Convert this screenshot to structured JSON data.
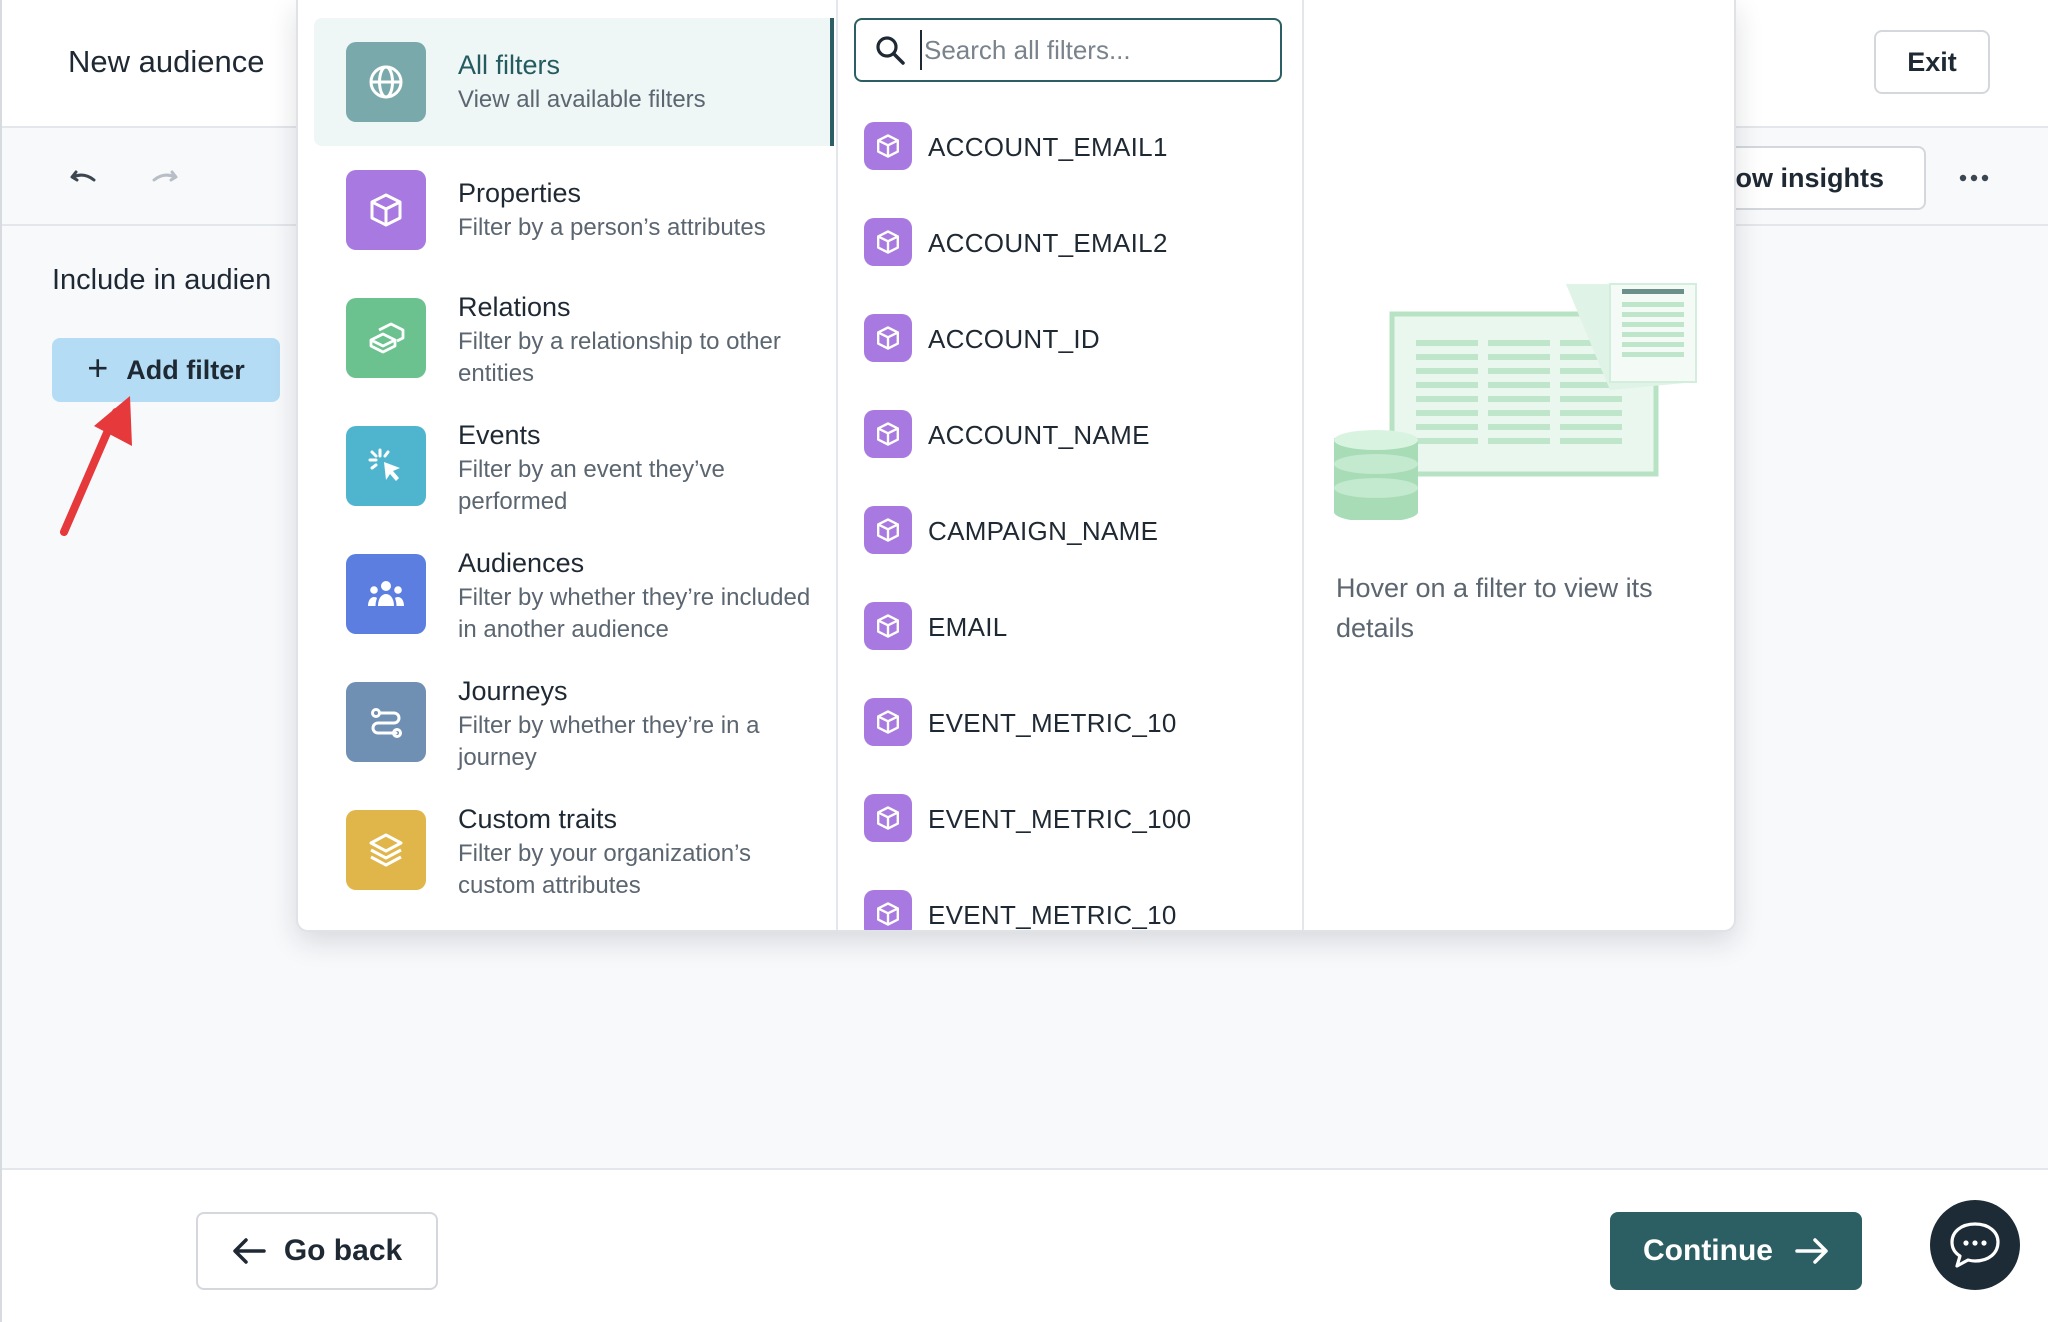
{
  "header": {
    "title": "New audience",
    "exit_label": "Exit"
  },
  "toolbar": {
    "undo_icon": "undo-icon",
    "redo_icon": "redo-icon",
    "insights_label": "how insights",
    "more_icon": "ellipsis-icon"
  },
  "main": {
    "include_label": "Include in audien",
    "add_filter_label": "Add filter"
  },
  "popover": {
    "categories": [
      {
        "title": "All filters",
        "desc": "View all available filters",
        "icon": "globe-icon",
        "color": "#7aa9ab"
      },
      {
        "title": "Properties",
        "desc": "Filter by a person’s attributes",
        "icon": "cube-icon",
        "color": "#a879e0"
      },
      {
        "title": "Relations",
        "desc": "Filter by a relationship to other entities",
        "icon": "relations-icon",
        "color": "#6cc28f"
      },
      {
        "title": "Events",
        "desc": "Filter by an event they’ve performed",
        "icon": "click-icon",
        "color": "#4fb5cf"
      },
      {
        "title": "Audiences",
        "desc": "Filter by whether they’re included in another audience",
        "icon": "people-icon",
        "color": "#5b7ee0"
      },
      {
        "title": "Journeys",
        "desc": "Filter by whether they’re in a journey",
        "icon": "journey-icon",
        "color": "#6f8fb3"
      },
      {
        "title": "Custom traits",
        "desc": "Filter by your organization’s custom attributes",
        "icon": "layers-icon",
        "color": "#e0b54a"
      }
    ],
    "search": {
      "placeholder": "Search all filters...",
      "value": ""
    },
    "filters": [
      "ACCOUNT_EMAIL1",
      "ACCOUNT_EMAIL2",
      "ACCOUNT_ID",
      "ACCOUNT_NAME",
      "CAMPAIGN_NAME",
      "EMAIL",
      "EVENT_METRIC_10",
      "EVENT_METRIC_100",
      "EVENT_METRIC_10"
    ],
    "detail_hint": "Hover on a filter to view its details"
  },
  "footer": {
    "go_back_label": "Go back",
    "continue_label": "Continue"
  },
  "colors": {
    "accent": "#2c5f63",
    "add_filter_bg": "#b4ddf5",
    "annotation": "#e5393b"
  }
}
